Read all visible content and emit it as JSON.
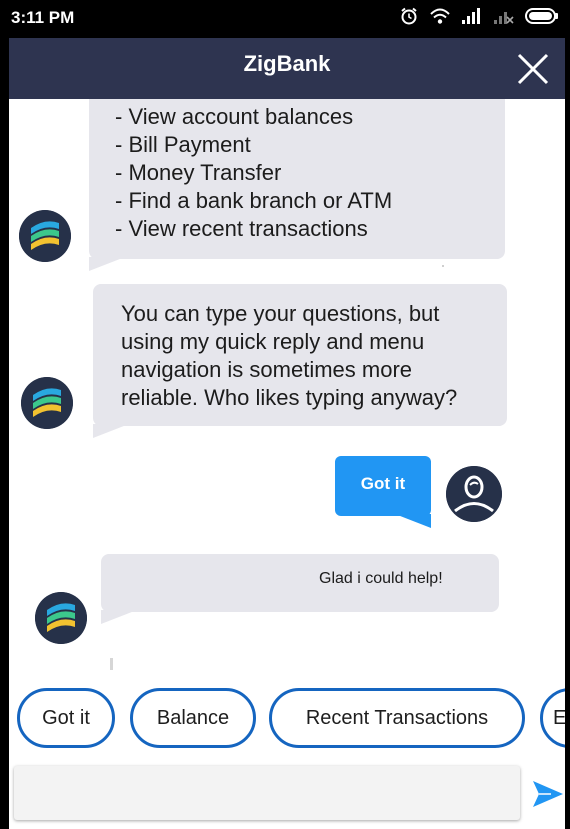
{
  "status_bar": {
    "time": "3:11 PM",
    "icons": [
      "alarm-icon",
      "wifi-icon",
      "signal-icon",
      "no-signal-icon",
      "battery-icon"
    ]
  },
  "header": {
    "title": "ZigBank",
    "close_icon": "close-icon",
    "background_color": "#2e3450"
  },
  "messages": [
    {
      "from": "bot",
      "lines": [
        "- View account balances",
        "- Bill Payment",
        "- Money Transfer",
        "- Find a bank branch or ATM",
        "- View recent transactions"
      ]
    },
    {
      "from": "bot",
      "lines": [
        "You can type your questions, but",
        "using my quick reply and menu",
        "navigation is sometimes more",
        "reliable. Who likes typing anyway?"
      ]
    },
    {
      "from": "user",
      "text": "Got it"
    },
    {
      "from": "bot",
      "text": "Glad i could help!"
    }
  ],
  "quick_replies": [
    "Got it",
    "Balance",
    "Recent Transactions",
    "E"
  ],
  "composer": {
    "placeholder": "",
    "value": "",
    "send_icon": "send-icon"
  },
  "colors": {
    "accent": "#2196f3",
    "quick_reply_border": "#1565c0",
    "bot_bubble": "#e6e6ec"
  }
}
